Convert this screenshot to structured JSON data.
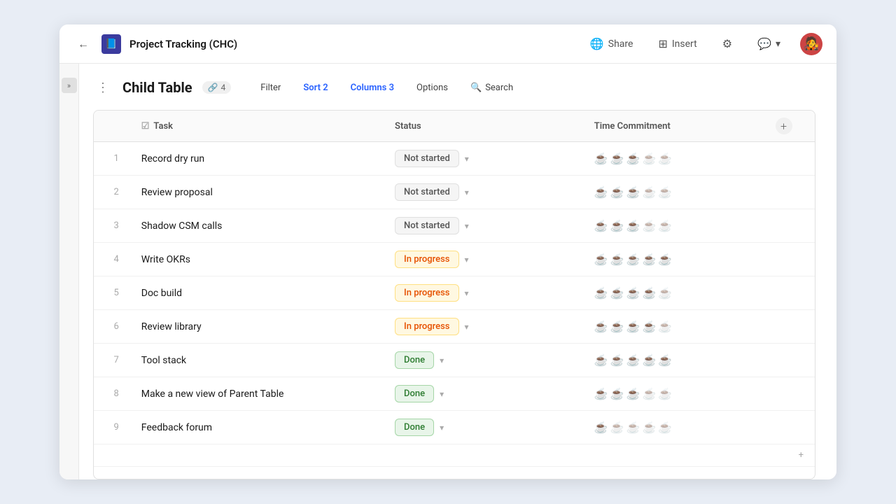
{
  "topbar": {
    "back_label": "←",
    "doc_icon": "📘",
    "title": "Project Tracking (CHC)",
    "share_label": "Share",
    "insert_label": "Insert",
    "settings_icon": "⚙",
    "comment_icon": "💬",
    "avatar_emoji": "🧑‍🎤"
  },
  "sidebar_toggle": {
    "icon": "»"
  },
  "table_header": {
    "more_icon": "⋮",
    "title": "Child Table",
    "link_icon": "🔗",
    "link_count": "4"
  },
  "toolbar": {
    "filter_label": "Filter",
    "sort_label": "Sort 2",
    "columns_label": "Columns 3",
    "options_label": "Options",
    "search_icon": "🔍",
    "search_label": "Search"
  },
  "table": {
    "columns": {
      "row_num": "#",
      "task": "Task",
      "status": "Status",
      "time": "Time Commitment",
      "add": "+"
    },
    "task_icon": "☑",
    "rows": [
      {
        "num": 1,
        "task": "Record dry run",
        "status": "Not started",
        "status_class": "not-started",
        "cups_filled": 3,
        "cups_total": 5
      },
      {
        "num": 2,
        "task": "Review proposal",
        "status": "Not started",
        "status_class": "not-started",
        "cups_filled": 3,
        "cups_total": 5
      },
      {
        "num": 3,
        "task": "Shadow CSM calls",
        "status": "Not started",
        "status_class": "not-started",
        "cups_filled": 3,
        "cups_total": 5
      },
      {
        "num": 4,
        "task": "Write OKRs",
        "status": "In progress",
        "status_class": "in-progress",
        "cups_filled": 5,
        "cups_total": 5
      },
      {
        "num": 5,
        "task": "Doc build",
        "status": "In progress",
        "status_class": "in-progress",
        "cups_filled": 4,
        "cups_total": 5
      },
      {
        "num": 6,
        "task": "Review library",
        "status": "In progress",
        "status_class": "in-progress",
        "cups_filled": 4,
        "cups_total": 5
      },
      {
        "num": 7,
        "task": "Tool stack",
        "status": "Done",
        "status_class": "done",
        "cups_filled": 5,
        "cups_total": 5
      },
      {
        "num": 8,
        "task": "Make a new view of Parent Table",
        "status": "Done",
        "status_class": "done",
        "cups_filled": 3,
        "cups_total": 5
      },
      {
        "num": 9,
        "task": "Feedback forum",
        "status": "Done",
        "status_class": "done",
        "cups_filled": 1,
        "cups_total": 5
      }
    ],
    "add_row_icon": "+"
  }
}
